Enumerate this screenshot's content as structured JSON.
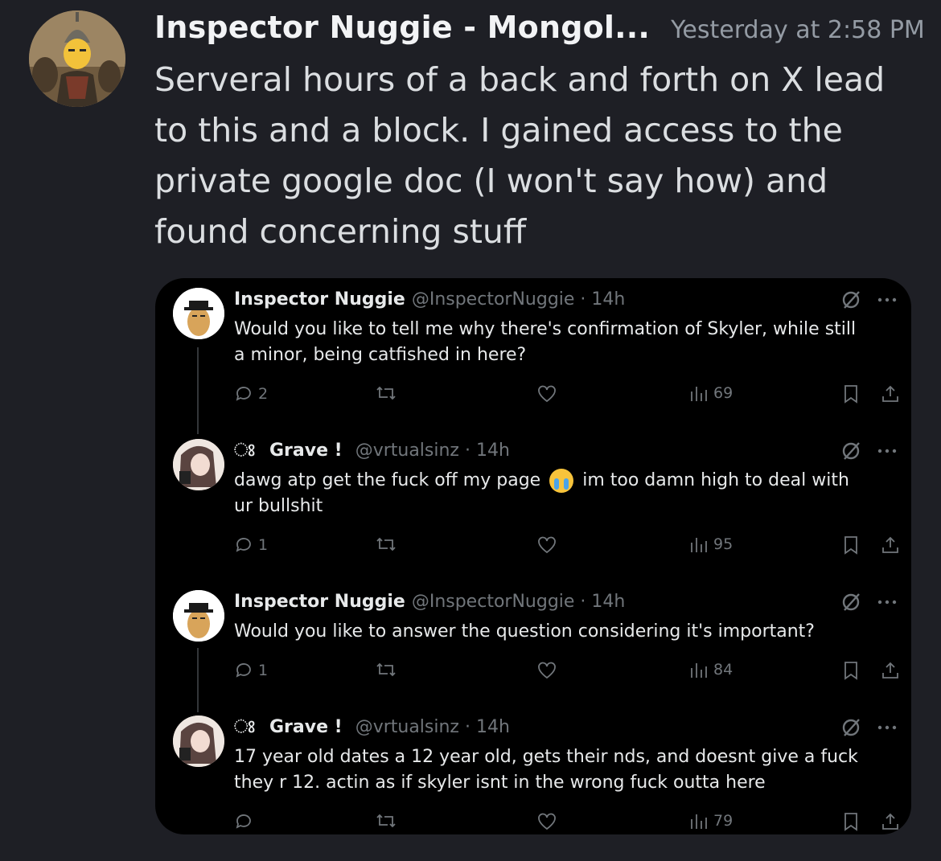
{
  "message": {
    "author": "Inspector Nuggie - Mongol...",
    "timestamp": "Yesterday at 2:58 PM",
    "text": "Serveral hours of a back and forth on X lead to this and a block. I gained access to the private google doc (I won't say how) and found concerning stuff"
  },
  "tweets": [
    {
      "name": "Inspector Nuggie",
      "handle": "@InspectorNuggie · 14h",
      "body": "Would you like to tell me why there's confirmation of Skyler, while still a minor, being catfished in here?",
      "replies": "2",
      "retweets": "",
      "likes": "",
      "views": "69"
    },
    {
      "glyph": "ଃ͏ ",
      "name": "Grave !",
      "handle": "@vrtualsinz · 14h",
      "body_a": "dawg atp get the fuck off my page",
      "body_b": "im too damn high to deal with ur bullshit",
      "replies": "1",
      "retweets": "",
      "likes": "",
      "views": "95"
    },
    {
      "name": "Inspector Nuggie",
      "handle": "@InspectorNuggie · 14h",
      "body": "Would you like to answer the question considering it's important?",
      "replies": "1",
      "retweets": "",
      "likes": "",
      "views": "84"
    },
    {
      "glyph": "ଃ͏ ",
      "name": "Grave !",
      "handle": "@vrtualsinz · 14h",
      "body": "17 year old dates a 12 year old, gets their nds, and doesnt give a fuck they r 12. actin as if skyler isnt in the wrong fuck outta here",
      "replies": "",
      "retweets": "",
      "likes": "",
      "views": "79"
    }
  ],
  "icons": {
    "grok": "grok-icon",
    "more": "more-icon",
    "reply": "reply-icon",
    "retweet": "retweet-icon",
    "like": "like-icon",
    "views": "views-icon",
    "bookmark": "bookmark-icon",
    "share": "share-icon"
  },
  "colors": {
    "background": "#1e1f25",
    "embed_background": "#000000",
    "muted": "#71767b"
  }
}
